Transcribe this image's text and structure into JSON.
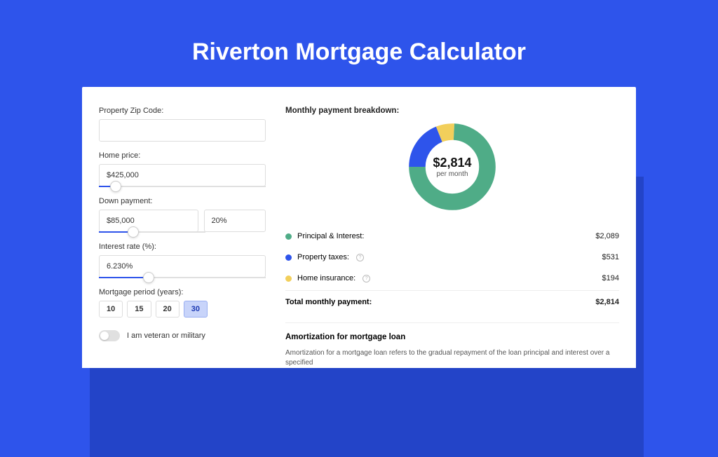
{
  "hero": {
    "title": "Riverton Mortgage Calculator"
  },
  "form": {
    "zip_label": "Property Zip Code:",
    "zip_value": "",
    "home_label": "Home price:",
    "home_value": "$425,000",
    "home_slider_pct": 10,
    "down_label": "Down payment:",
    "down_value": "$85,000",
    "down_pct": "20%",
    "down_slider_pct": 20,
    "rate_label": "Interest rate (%):",
    "rate_value": "6.230%",
    "rate_slider_pct": 30,
    "period_label": "Mortgage period (years):",
    "periods": [
      "10",
      "15",
      "20",
      "30"
    ],
    "period_active": "30",
    "vet_label": "I am veteran or military",
    "vet_on": false
  },
  "breakdown": {
    "title": "Monthly payment breakdown:",
    "total": "$2,814",
    "per": "per month",
    "items": [
      {
        "label": "Principal & Interest:",
        "value": "$2,089",
        "color": "#4fac87",
        "info": false
      },
      {
        "label": "Property taxes:",
        "value": "$531",
        "color": "#2e54eb",
        "info": true
      },
      {
        "label": "Home insurance:",
        "value": "$194",
        "color": "#f2cf5b",
        "info": true
      }
    ],
    "total_label": "Total monthly payment:",
    "total_value": "$2,814"
  },
  "chart_data": {
    "type": "pie",
    "title": "Monthly payment breakdown",
    "series": [
      {
        "name": "Principal & Interest",
        "value": 2089,
        "color": "#4fac87"
      },
      {
        "name": "Property taxes",
        "value": 531,
        "color": "#2e54eb"
      },
      {
        "name": "Home insurance",
        "value": 194,
        "color": "#f2cf5b"
      }
    ],
    "total": 2814
  },
  "amort": {
    "title": "Amortization for mortgage loan",
    "body": "Amortization for a mortgage loan refers to the gradual repayment of the loan principal and interest over a specified"
  }
}
